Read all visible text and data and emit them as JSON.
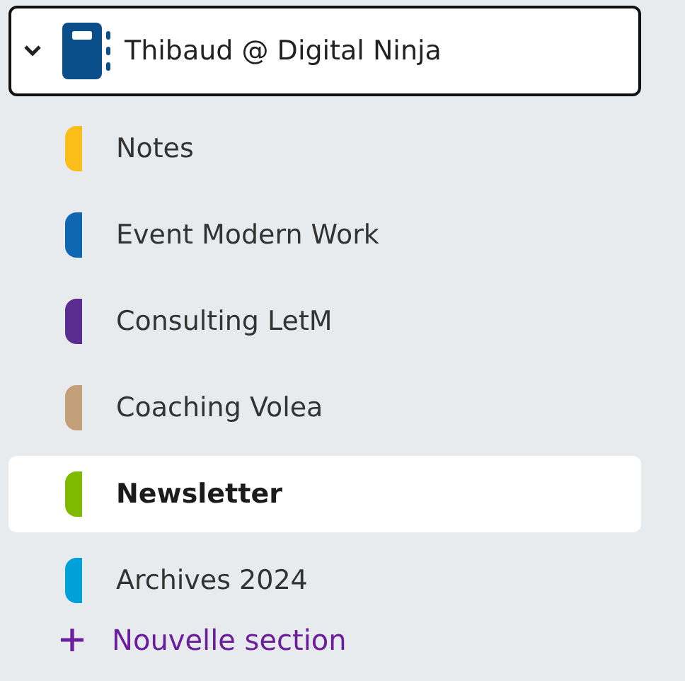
{
  "notebook": {
    "name": "Thibaud @ Digital Ninja",
    "expanded": true,
    "color": "#0b4f8a"
  },
  "sections": [
    {
      "name": "Notes",
      "color": "#fbbd18",
      "selected": false
    },
    {
      "name": "Event Modern Work",
      "color": "#0f67b1",
      "selected": false
    },
    {
      "name": "Consulting LetM",
      "color": "#5c2d91",
      "selected": false
    },
    {
      "name": "Coaching Volea",
      "color": "#c4a07a",
      "selected": false
    },
    {
      "name": "Newsletter",
      "color": "#7fba00",
      "selected": true
    },
    {
      "name": "Archives 2024",
      "color": "#00a0d8",
      "selected": false
    }
  ],
  "add_section": {
    "label": "Nouvelle section"
  }
}
